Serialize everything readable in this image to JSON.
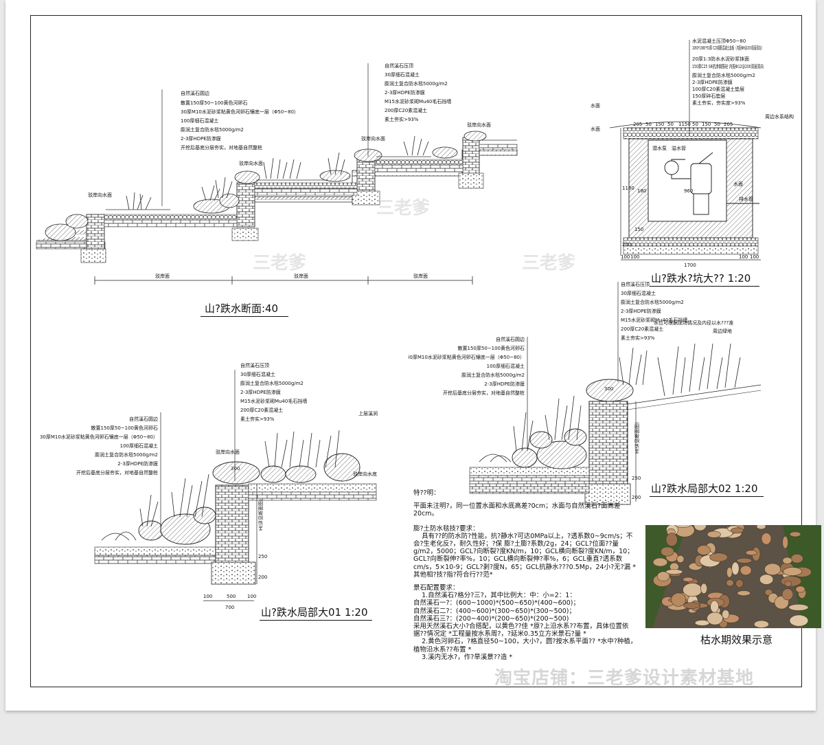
{
  "sheet": {
    "watermarks": [
      "三老爹",
      "三老爹",
      "三老爹"
    ],
    "shop_watermark": "淘宝店铺：三老爹设计素材基地"
  },
  "main_section": {
    "title": "山?跌水断面:40",
    "labels": [
      "驳岸向水面",
      "驳岸向水面",
      "驳岸向水面",
      "驳岸向水面"
    ],
    "spans": [
      "驳岸面",
      "驳岸面",
      "驳岸面"
    ],
    "callout_left": [
      "自然溪石圆边",
      "散置150厚50~100黄色河卵石",
      "30厚M10水泥砂浆粘黄色河卵石镶底一层（Φ50~80）",
      "100厚细石混凝土",
      "膨润土复合防水毯5000g/m2",
      "2-3厚HDPE防渗膜",
      "开挖后基底分层夯实，对地基自然整桩"
    ],
    "callout_right": [
      "自然溪石压顶",
      "30厚细石混凝土",
      "膨润土复合防水毯5000g/m2",
      "2-3厚HDPE防渗膜",
      "M15水泥砂浆砌Mu40毛石挡墙",
      "200厚C20素混凝土",
      "素土夯实>93%"
    ]
  },
  "pit_section": {
    "title": "山?跌水?坑大?? 1:20",
    "callout": [
      "水泥混凝土压顶Φ50~80",
      "1060*1060*50厚 C20钢筋混凝土盖板（内配Φ8@200双层双向）",
      "20厚1:3防水水泥砂浆抹面",
      "150厚C25 S6抗渗钢筋砼 内配Φ12@200双层双向",
      "膨润土复合防水毯5000g/m2",
      "2-3厚HDPE防渗膜",
      "100厚C20素混凝土垫层",
      "150厚碎石垫层",
      "素土夯实，夯实度>93%"
    ],
    "labels": [
      "水面",
      "水面",
      "水面",
      "周边水系结构",
      "潜水泵",
      "溢水管",
      "排水管"
    ],
    "dims_top": [
      "205",
      "50",
      "150",
      "50",
      "1150",
      "50",
      "150",
      "50",
      "205"
    ],
    "dims_side": [
      "1180",
      "150",
      "960",
      "180",
      "200"
    ],
    "dims_bottom": [
      "100",
      "100",
      "1700",
      "100",
      "100"
    ]
  },
  "detail_01": {
    "title": "山?跌水局部大01 1:20",
    "callout_left": [
      "自然溪石圆边",
      "散置150厚50~100黄色河卵石",
      "30厚M10水泥砂浆粘黄色河卵石镶底一层（Φ50~80）",
      "100厚细石混凝土",
      "膨润土复合防水毯5000g/m2",
      "2-3厚HDPE防渗膜",
      "开挖后基底分层夯实，对地基自然整桩"
    ],
    "callout_right": [
      "自然溪石压顶",
      "30厚细石混凝土",
      "膨润土复合防水毯5000g/m2",
      "2-3厚HDPE防渗膜",
      "M15水泥砂浆砌Mu40毛石挡墙",
      "200厚C20素混凝土",
      "素土夯实>93%"
    ],
    "labels": [
      "上层溪涧",
      "驳岸向水面",
      "驳岸向水底"
    ],
    "dims": [
      "300",
      "250",
      "200",
      "100",
      "500",
      "100",
      "700"
    ],
    "height_label": "H(详见断面图)"
  },
  "detail_02": {
    "title": "山?跌水局部大02 1:20",
    "callout_left": [
      "自然溪石圆边",
      "散置150厚50~100黄色河卵石",
      "i0厚M10水泥砂浆粘黄色河卵石镶底一层（Φ50~80）",
      "100厚细石混凝土",
      "膨润土复合防水毯5000g/m2",
      "2-3厚HDPE防渗膜",
      "开挖后基底分层夯实，对地基自然整桩"
    ],
    "callout_right": [
      "自然溪石压顶",
      "30厚细石混凝土",
      "膨润土复合防水毯5000g/m2",
      "2-3厚HDPE防渗膜",
      "M15水泥砂浆砌Mu40毛石挡墙",
      "200厚C20素混凝土",
      "素土夯实>93%"
    ],
    "labels": [
      "周边绿地"
    ],
    "note": "水位可根据现场情况及内径以水???准",
    "dims": [
      "300",
      "250",
      "200"
    ],
    "height_label": "H(详见断面图)"
  },
  "notes": {
    "heading": "特??明：",
    "para1": "平面未注明?，同一位置水面和水底高差?0cm；水面与自然溪石?面高差20cm。",
    "heading2": "膨?土防水毯技?要求：",
    "para2": "    具有??的防水防?性能，抗?静水?可达0MPa以上，?透系数0~9cm/s；不会?生老化反?，耐久性好；?保 膨?土膨?系数/2g，24；GCL?位面??量g/m2，5000；GCL?向断裂?度KN/m，10；GCL横向断裂?度KN/m，10；GCL?向断裂伸?率%，10；GCL横向断裂伸?率%，6；GCL垂直?透系数cm/s，5×10-9；GCL?剥?度N，65；GCL抗静水???0.5Mp，24小?无?漏 *其他相?技?指?符合行??范*",
    "heading3": "景石配置要求：",
    "para3": "    1.自然溪石?格分?三?，其中比例大：中：小=2：1：\n自然溪石一?：(600~1000)*(500~650)*(400~600)；\n自然溪石二?：(400~600)*(300~650)*(300~500)；\n自然溪石三?：(200~400)*(200~650)*(200~500)\n采用天然溪石大小?合搭配，以黄色??佳 *原?上沿水系??布置，具体位置依据??情况定 *工程量按水系周?，?延米0.35立方米景石?量 *\n    2.黄色河卵石，?格直径50~100，大小?，圆?按水系平面?? *水中?种植，植物沿水系??布置 *\n    3.溪内无水?，作?旱溪景??造 *"
  },
  "photo": {
    "caption": "枯水期效果示意"
  }
}
